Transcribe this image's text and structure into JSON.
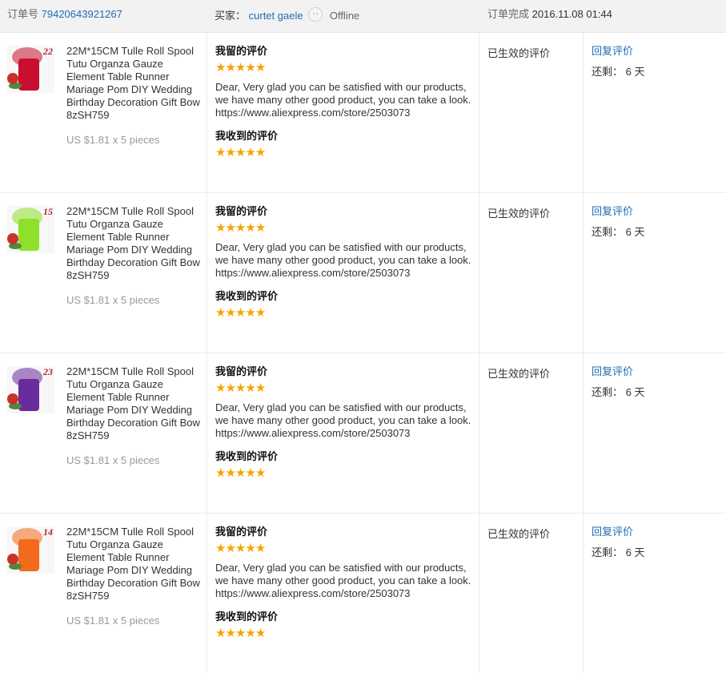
{
  "header": {
    "order_label": "订单号",
    "order_number": "79420643921267",
    "buyer_label": "买家：",
    "buyer_name": "curtet gaele",
    "buyer_status": "Offline",
    "completed_label": "订单完成",
    "completed_time": "2016.11.08 01:44"
  },
  "colors": {
    "link": "#1f6cb3",
    "star": "#f5a300",
    "header_bg": "#f2f2f2"
  },
  "rows": [
    {
      "thumb_number": "22",
      "thumb_color": "#c8102e",
      "title": "22M*15CM Tulle Roll Spool Tutu Organza Gauze Element Table Runner Mariage Pom DIY Wedding Birthday Decoration Gift Bow 8zSH759",
      "price": "US $1.81 x 5 pieces",
      "left_review_label": "我留的评价",
      "left_stars": 5,
      "reply_text": "Dear, Very glad you can be satisfied with our products, we have many other good product, you can take a look. https://www.aliexpress.com/store/2503073",
      "received_review_label": "我收到的评价",
      "received_stars": 5,
      "status": "已生效的评价",
      "action": "回复评价",
      "remaining": "还剩： 6 天"
    },
    {
      "thumb_number": "15",
      "thumb_color": "#8fe02a",
      "title": "22M*15CM Tulle Roll Spool Tutu Organza Gauze Element Table Runner Mariage Pom DIY Wedding Birthday Decoration Gift Bow 8zSH759",
      "price": "US $1.81 x 5 pieces",
      "left_review_label": "我留的评价",
      "left_stars": 5,
      "reply_text": "Dear, Very glad you can be satisfied with our products, we have many other good product, you can take a look. https://www.aliexpress.com/store/2503073",
      "received_review_label": "我收到的评价",
      "received_stars": 5,
      "status": "已生效的评价",
      "action": "回复评价",
      "remaining": "还剩： 6 天"
    },
    {
      "thumb_number": "23",
      "thumb_color": "#6a2c9c",
      "title": "22M*15CM Tulle Roll Spool Tutu Organza Gauze Element Table Runner Mariage Pom DIY Wedding Birthday Decoration Gift Bow 8zSH759",
      "price": "US $1.81 x 5 pieces",
      "left_review_label": "我留的评价",
      "left_stars": 5,
      "reply_text": "Dear, Very glad you can be satisfied with our products, we have many other good product, you can take a look. https://www.aliexpress.com/store/2503073",
      "received_review_label": "我收到的评价",
      "received_stars": 5,
      "status": "已生效的评价",
      "action": "回复评价",
      "remaining": "还剩： 6 天"
    },
    {
      "thumb_number": "14",
      "thumb_color": "#f26a1b",
      "title": "22M*15CM Tulle Roll Spool Tutu Organza Gauze Element Table Runner Mariage Pom DIY Wedding Birthday Decoration Gift Bow 8zSH759",
      "price": "US $1.81 x 5 pieces",
      "left_review_label": "我留的评价",
      "left_stars": 5,
      "reply_text": "Dear, Very glad you can be satisfied with our products, we have many other good product, you can take a look. https://www.aliexpress.com/store/2503073",
      "received_review_label": "我收到的评价",
      "received_stars": 5,
      "status": "已生效的评价",
      "action": "回复评价",
      "remaining": "还剩： 6 天"
    }
  ]
}
